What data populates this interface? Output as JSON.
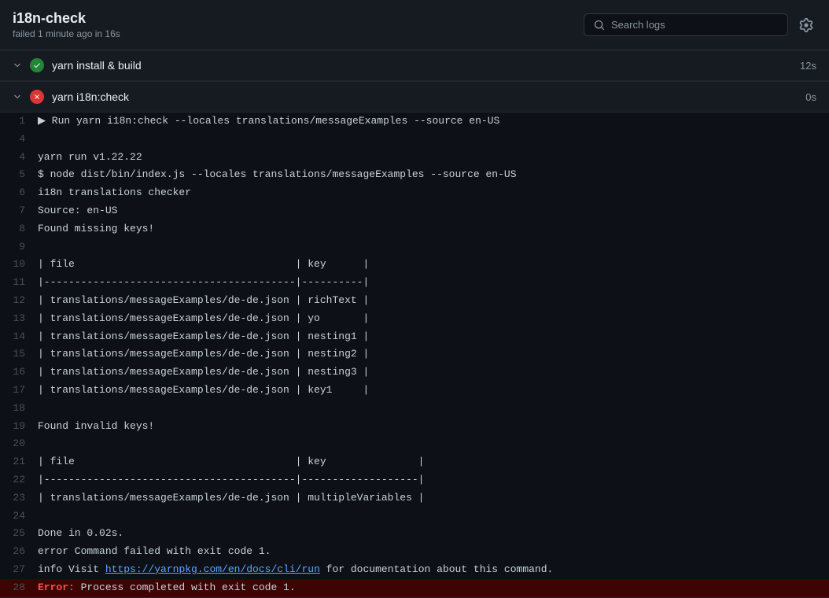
{
  "header": {
    "title": "i18n-check",
    "subtitle": "failed 1 minute ago in 16s",
    "search_placeholder": "Search logs"
  },
  "jobs": [
    {
      "id": "job-1",
      "name": "yarn install & build",
      "status": "success",
      "duration": "12s",
      "collapsed": true
    },
    {
      "id": "job-2",
      "name": "yarn i18n:check",
      "status": "failure",
      "duration": "0s",
      "collapsed": false
    }
  ],
  "log_lines": [
    {
      "num": "1",
      "content": "▶ Run yarn i18n:check --locales translations/messageExamples --source en-US",
      "type": "cmd"
    },
    {
      "num": "4",
      "content": "",
      "type": "normal"
    },
    {
      "num": "4",
      "content": "yarn run v1.22.22",
      "type": "normal"
    },
    {
      "num": "5",
      "content": "$ node dist/bin/index.js --locales translations/messageExamples --source en-US",
      "type": "normal"
    },
    {
      "num": "6",
      "content": "i18n translations checker",
      "type": "normal"
    },
    {
      "num": "7",
      "content": "Source: en-US",
      "type": "normal"
    },
    {
      "num": "8",
      "content": "Found missing keys!",
      "type": "normal"
    },
    {
      "num": "9",
      "content": "",
      "type": "normal"
    },
    {
      "num": "10",
      "content": "| file                                      | key      |",
      "type": "table"
    },
    {
      "num": "11",
      "content": "|-------------------------------------------|----------|",
      "type": "table"
    },
    {
      "num": "12",
      "content": "| translations/messageExamples/de-de.json   | richText |",
      "type": "table"
    },
    {
      "num": "13",
      "content": "| translations/messageExamples/de-de.json   | yo       |",
      "type": "table"
    },
    {
      "num": "14",
      "content": "| translations/messageExamples/de-de.json   | nesting1 |",
      "type": "table"
    },
    {
      "num": "15",
      "content": "| translations/messageExamples/de-de.json   | nesting2 |",
      "type": "table"
    },
    {
      "num": "16",
      "content": "| translations/messageExamples/de-de.json   | nesting3 |",
      "type": "table"
    },
    {
      "num": "17",
      "content": "| translations/messageExamples/de-de.json   | key1     |",
      "type": "table"
    },
    {
      "num": "18",
      "content": "",
      "type": "normal"
    },
    {
      "num": "19",
      "content": "Found invalid keys!",
      "type": "normal"
    },
    {
      "num": "20",
      "content": "",
      "type": "normal"
    },
    {
      "num": "21",
      "content": "| file                                      | key               |",
      "type": "table2"
    },
    {
      "num": "22",
      "content": "|-------------------------------------------|-------------------|",
      "type": "table2"
    },
    {
      "num": "23",
      "content": "| translations/messageExamples/de-de.json   | multipleVariables |",
      "type": "table2"
    },
    {
      "num": "24",
      "content": "",
      "type": "normal"
    },
    {
      "num": "25",
      "content": "Done in 0.02s.",
      "type": "normal"
    },
    {
      "num": "26",
      "content": "error Command failed with exit code 1.",
      "type": "normal"
    },
    {
      "num": "27",
      "content": "info Visit https://yarnpkg.com/en/docs/cli/run for documentation about this command.",
      "type": "link"
    },
    {
      "num": "28",
      "content": "Error: Process completed with exit code 1.",
      "type": "error"
    }
  ],
  "icons": {
    "check": "✓",
    "x": "✕",
    "chevron_down": "▼",
    "search": "🔍",
    "gear": "⚙"
  }
}
